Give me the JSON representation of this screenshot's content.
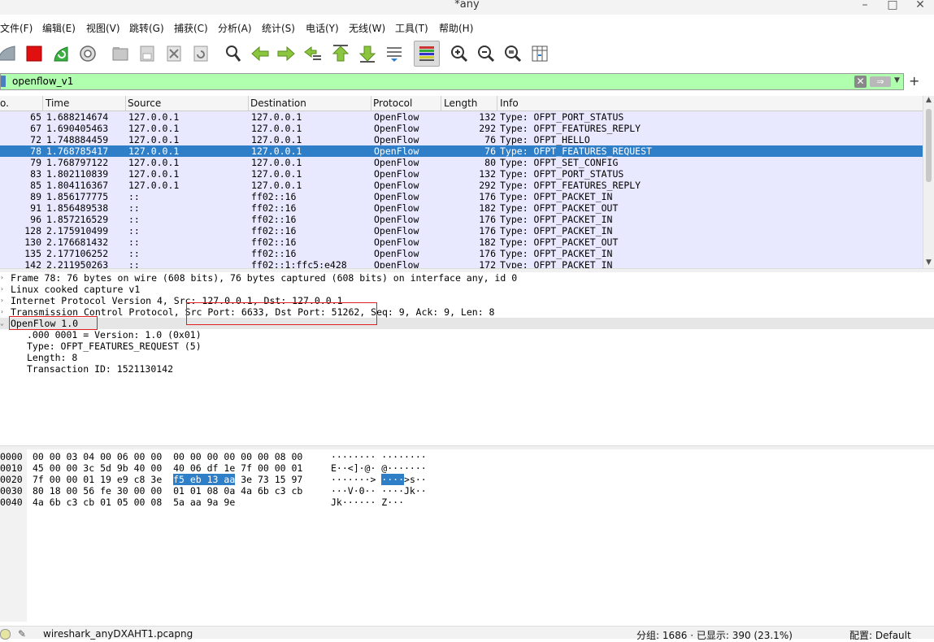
{
  "window": {
    "title": "*any"
  },
  "menu": [
    "文件(F)",
    "编辑(E)",
    "视图(V)",
    "跳转(G)",
    "捕获(C)",
    "分析(A)",
    "统计(S)",
    "电话(Y)",
    "无线(W)",
    "工具(T)",
    "帮助(H)"
  ],
  "filter": {
    "value": "openflow_v1"
  },
  "columns": [
    "o.",
    "Time",
    "Source",
    "Destination",
    "Protocol",
    "Length",
    "Info"
  ],
  "packets": [
    {
      "no": "65",
      "time": "1.688214674",
      "src": "127.0.0.1",
      "dst": "127.0.0.1",
      "proto": "OpenFlow",
      "len": "132",
      "info": "Type: OFPT_PORT_STATUS"
    },
    {
      "no": "67",
      "time": "1.690405463",
      "src": "127.0.0.1",
      "dst": "127.0.0.1",
      "proto": "OpenFlow",
      "len": "292",
      "info": "Type: OFPT_FEATURES_REPLY"
    },
    {
      "no": "72",
      "time": "1.748884459",
      "src": "127.0.0.1",
      "dst": "127.0.0.1",
      "proto": "OpenFlow",
      "len": "76",
      "info": "Type: OFPT_HELLO"
    },
    {
      "no": "78",
      "time": "1.768785417",
      "src": "127.0.0.1",
      "dst": "127.0.0.1",
      "proto": "OpenFlow",
      "len": "76",
      "info": "Type: OFPT_FEATURES_REQUEST",
      "selected": true
    },
    {
      "no": "79",
      "time": "1.768797122",
      "src": "127.0.0.1",
      "dst": "127.0.0.1",
      "proto": "OpenFlow",
      "len": "80",
      "info": "Type: OFPT_SET_CONFIG"
    },
    {
      "no": "83",
      "time": "1.802110839",
      "src": "127.0.0.1",
      "dst": "127.0.0.1",
      "proto": "OpenFlow",
      "len": "132",
      "info": "Type: OFPT_PORT_STATUS"
    },
    {
      "no": "85",
      "time": "1.804116367",
      "src": "127.0.0.1",
      "dst": "127.0.0.1",
      "proto": "OpenFlow",
      "len": "292",
      "info": "Type: OFPT_FEATURES_REPLY"
    },
    {
      "no": "89",
      "time": "1.856177775",
      "src": "::",
      "dst": "ff02::16",
      "proto": "OpenFlow",
      "len": "176",
      "info": "Type: OFPT_PACKET_IN"
    },
    {
      "no": "91",
      "time": "1.856489538",
      "src": "::",
      "dst": "ff02::16",
      "proto": "OpenFlow",
      "len": "182",
      "info": "Type: OFPT_PACKET_OUT"
    },
    {
      "no": "96",
      "time": "1.857216529",
      "src": "::",
      "dst": "ff02::16",
      "proto": "OpenFlow",
      "len": "176",
      "info": "Type: OFPT_PACKET_IN"
    },
    {
      "no": "128",
      "time": "2.175910499",
      "src": "::",
      "dst": "ff02::16",
      "proto": "OpenFlow",
      "len": "176",
      "info": "Type: OFPT_PACKET_IN"
    },
    {
      "no": "130",
      "time": "2.176681432",
      "src": "::",
      "dst": "ff02::16",
      "proto": "OpenFlow",
      "len": "182",
      "info": "Type: OFPT_PACKET_OUT"
    },
    {
      "no": "135",
      "time": "2.177106252",
      "src": "::",
      "dst": "ff02::16",
      "proto": "OpenFlow",
      "len": "176",
      "info": "Type: OFPT_PACKET_IN"
    },
    {
      "no": "142",
      "time": "2.211950263",
      "src": "::",
      "dst": "ff02::1:ffc5:e428",
      "proto": "OpenFlow",
      "len": "172",
      "info": "Type: OFPT_PACKET_IN"
    }
  ],
  "details": {
    "frame": "Frame 78: 76 bytes on wire (608 bits), 76 bytes captured (608 bits) on interface any, id 0",
    "linux": "Linux cooked capture v1",
    "ip": "Internet Protocol Version 4, Src: 127.0.0.1, Dst: 127.0.0.1",
    "tcp_a": "Transmission Control Protocol,",
    "tcp_b": "Src Port: 6633, Dst Port: 51262",
    "tcp_c": ", Seq: 9, Ack: 9, Len: 8",
    "openflow": "OpenFlow 1.0",
    "version": ".000 0001 = Version: 1.0 (0x01)",
    "type": "Type: OFPT_FEATURES_REQUEST (5)",
    "length": "Length: 8",
    "xid": "Transaction ID: 1521130142"
  },
  "bytes": [
    {
      "off": "0000",
      "hex_a": "00 00 03 04 00 06 00 00  00 00 00 00 00 00 08 00",
      "hl": "",
      "hex_b": "",
      "ascii_a": "········ ········",
      "ascii_hl": "",
      "ascii_b": ""
    },
    {
      "off": "0010",
      "hex_a": "45 00 00 3c 5d 9b 40 00  40 06 df 1e 7f 00 00 01",
      "hl": "",
      "hex_b": "",
      "ascii_a": "E··<]·@· @·······",
      "ascii_hl": "",
      "ascii_b": ""
    },
    {
      "off": "0020",
      "hex_a": "7f 00 00 01 19 e9 c8 3e  ",
      "hl": "f5 eb 13 aa",
      "hex_b": " 3e 73 15 97",
      "ascii_a": "·······> ",
      "ascii_hl": "····",
      "ascii_b": ">s··"
    },
    {
      "off": "0030",
      "hex_a": "80 18 00 56 fe 30 00 00  01 01 08 0a 4a 6b c3 cb",
      "hl": "",
      "hex_b": "",
      "ascii_a": "···V·0·· ····Jk··",
      "ascii_hl": "",
      "ascii_b": ""
    },
    {
      "off": "0040",
      "hex_a": "4a 6b c3 cb 01 05 00 08  5a aa 9a 9e",
      "hl": "",
      "hex_b": "",
      "ascii_a": "Jk······ Z···",
      "ascii_hl": "",
      "ascii_b": ""
    }
  ],
  "status": {
    "file": "wireshark_anyDXAHT1.pcapng",
    "counts": "分组: 1686 · 已显示: 390 (23.1%)",
    "profile": "配置: Default"
  }
}
